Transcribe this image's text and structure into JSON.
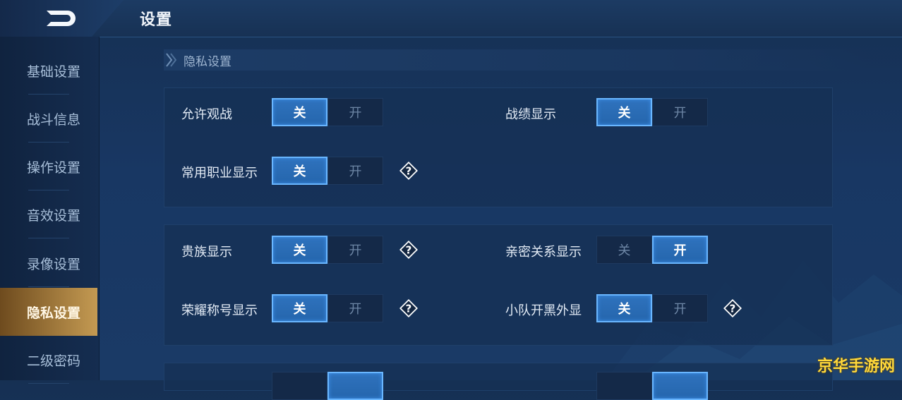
{
  "header": {
    "title": "设置"
  },
  "sidebar": {
    "items": [
      {
        "label": "基础设置"
      },
      {
        "label": "战斗信息"
      },
      {
        "label": "操作设置"
      },
      {
        "label": "音效设置"
      },
      {
        "label": "录像设置"
      },
      {
        "label": "隐私设置"
      },
      {
        "label": "二级密码"
      }
    ],
    "active_index": 5
  },
  "section": {
    "title": "隐私设置"
  },
  "toggle_labels": {
    "off": "关",
    "on": "开"
  },
  "settings": {
    "allow_spectate": {
      "label": "允许观战",
      "value": "关"
    },
    "record_display": {
      "label": "战绩显示",
      "value": "关"
    },
    "common_role_display": {
      "label": "常用职业显示",
      "value": "关"
    },
    "noble_display": {
      "label": "贵族显示",
      "value": "关"
    },
    "intimacy_display": {
      "label": "亲密关系显示",
      "value": "开"
    },
    "honor_title_display": {
      "label": "荣耀称号显示",
      "value": "关"
    },
    "team_open_display": {
      "label": "小队开黑外显",
      "value": "关"
    }
  },
  "help_icon": "question-diamond-icon",
  "watermark": {
    "text": "京华手游网"
  },
  "colors": {
    "accent": "#2a6fba",
    "active_tab": "#c49a52",
    "watermark": "#ffd83a"
  }
}
